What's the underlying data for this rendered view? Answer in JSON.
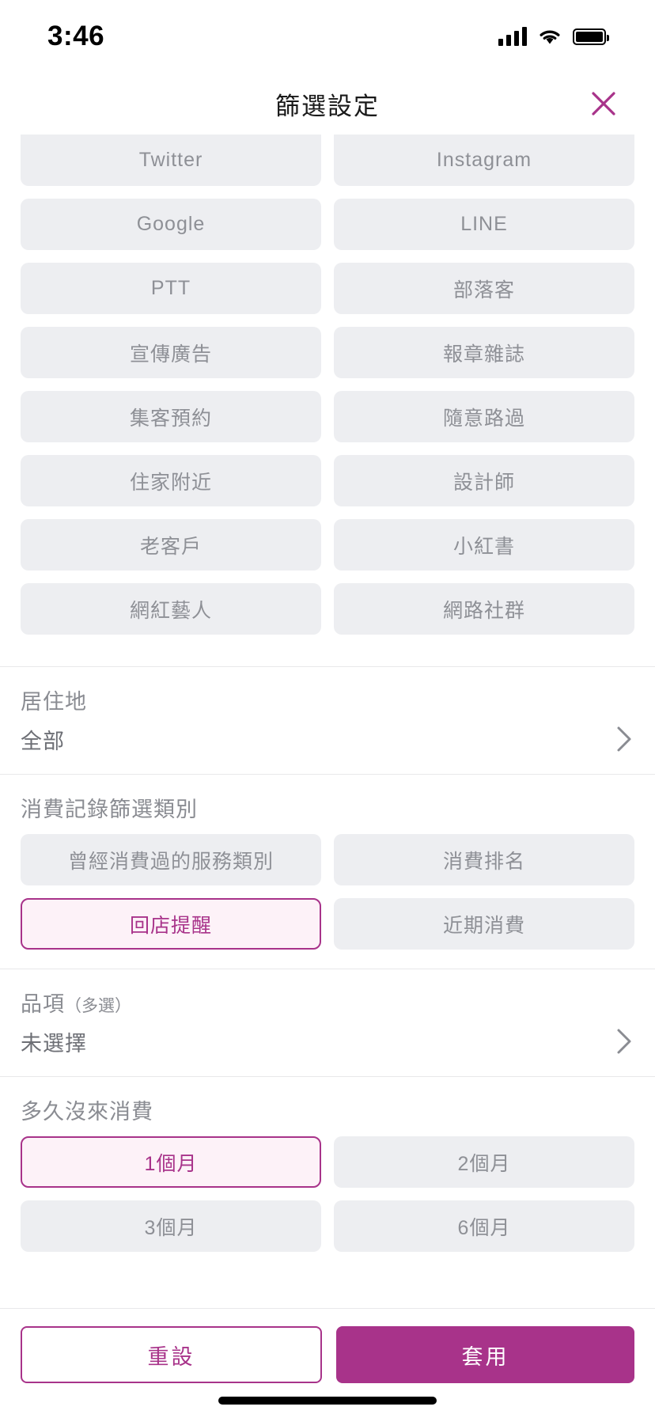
{
  "status_bar": {
    "time": "3:46",
    "signal_icon": "cellular-signal-icon",
    "wifi_icon": "wifi-icon",
    "battery_icon": "battery-icon"
  },
  "header": {
    "title": "篩選設定",
    "close_icon": "close-icon"
  },
  "colors": {
    "accent": "#a8338a",
    "chip_bg": "#edeef1",
    "chip_text": "#8e9096",
    "selected_bg": "#fdf2f8",
    "divider": "#e8e8ea"
  },
  "source_chips": [
    {
      "label": "Twitter",
      "selected": false
    },
    {
      "label": "Instagram",
      "selected": false
    },
    {
      "label": "Google",
      "selected": false
    },
    {
      "label": "LINE",
      "selected": false
    },
    {
      "label": "PTT",
      "selected": false
    },
    {
      "label": "部落客",
      "selected": false
    },
    {
      "label": "宣傳廣告",
      "selected": false
    },
    {
      "label": "報章雜誌",
      "selected": false
    },
    {
      "label": "集客預約",
      "selected": false
    },
    {
      "label": "隨意路過",
      "selected": false
    },
    {
      "label": "住家附近",
      "selected": false
    },
    {
      "label": "設計師",
      "selected": false
    },
    {
      "label": "老客戶",
      "selected": false
    },
    {
      "label": "小紅書",
      "selected": false
    },
    {
      "label": "網紅藝人",
      "selected": false
    },
    {
      "label": "網路社群",
      "selected": false
    }
  ],
  "residence": {
    "label": "居住地",
    "value": "全部",
    "chevron_icon": "chevron-right-icon"
  },
  "spending_category": {
    "label": "消費記錄篩選類別",
    "chips": [
      {
        "label": "曾經消費過的服務類別",
        "selected": false
      },
      {
        "label": "消費排名",
        "selected": false
      },
      {
        "label": "回店提醒",
        "selected": true
      },
      {
        "label": "近期消費",
        "selected": false
      }
    ]
  },
  "item": {
    "label": "品項",
    "label_sub": "（多選）",
    "value": "未選擇",
    "chevron_icon": "chevron-right-icon"
  },
  "last_visit": {
    "label": "多久沒來消費",
    "chips": [
      {
        "label": "1個月",
        "selected": true
      },
      {
        "label": "2個月",
        "selected": false
      },
      {
        "label": "3個月",
        "selected": false
      },
      {
        "label": "6個月",
        "selected": false
      }
    ]
  },
  "footer": {
    "reset_label": "重設",
    "apply_label": "套用"
  }
}
